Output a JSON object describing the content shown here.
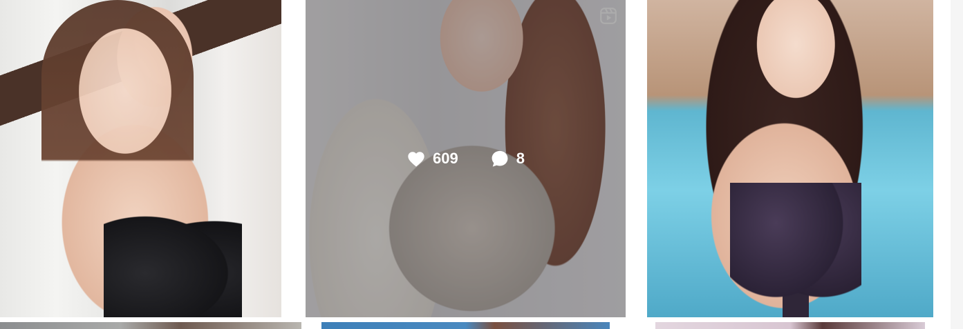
{
  "grid": {
    "posts": [
      {
        "kind": "photo"
      },
      {
        "kind": "reel",
        "likes": "609",
        "comments": "8",
        "hovered": true
      },
      {
        "kind": "photo"
      },
      {
        "kind": "photo"
      },
      {
        "kind": "photo"
      },
      {
        "kind": "photo"
      }
    ]
  },
  "icons": {
    "likes": "heart-icon",
    "comments": "comment-icon",
    "reel": "reels-icon"
  },
  "colors": {
    "overlay": "#000000",
    "stats_text": "#ffffff"
  }
}
